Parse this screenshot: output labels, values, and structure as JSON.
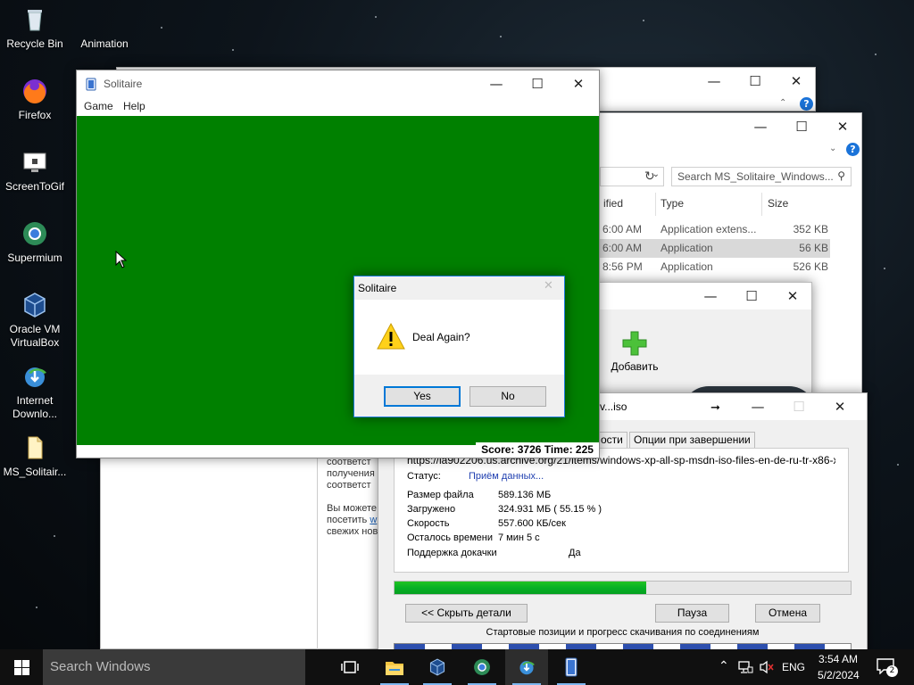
{
  "desktop": {
    "icons": [
      {
        "label": "Recycle Bin",
        "icon": "recycle-bin-icon"
      },
      {
        "label": "Animation",
        "icon": "animation-icon"
      },
      {
        "label": "Firefox",
        "icon": "firefox-icon"
      },
      {
        "label": "ScreenToGif",
        "icon": "screentogif-icon"
      },
      {
        "label": "Supermium",
        "icon": "supermium-icon"
      },
      {
        "label": "Oracle VM VirtualBox",
        "icon": "virtualbox-icon"
      },
      {
        "label": "Internet Downlo...",
        "icon": "idm-icon"
      },
      {
        "label": "MS_Solitair...",
        "icon": "file-icon"
      }
    ]
  },
  "explorer": {
    "search_placeholder": "Search MS_Solitaire_Windows...",
    "columns": {
      "modified": "ified",
      "type": "Type",
      "size": "Size"
    },
    "rows": [
      {
        "modified": "6:00 AM",
        "type": "Application extens...",
        "size": "352 KB",
        "selected": false
      },
      {
        "modified": "6:00 AM",
        "type": "Application",
        "size": "56 KB",
        "selected": true
      },
      {
        "modified": "8:56 PM",
        "type": "Application",
        "size": "526 KB",
        "selected": false
      }
    ]
  },
  "info_window": {
    "lines": [
      "соответст",
      "получения",
      "соответст",
      "",
      "Вы можете",
      "посетить",
      "свежих нов"
    ]
  },
  "idm_add": {
    "add_label": "Добавить"
  },
  "download": {
    "title": "rv...iso",
    "tabs": [
      "ости",
      "Опции при завершении"
    ],
    "url": "https://ia902206.us.archive.org/21/items/windows-xp-all-sp-msdn-iso-files-en-de-ru-tr-x86-x64/en_",
    "status_label": "Статус:",
    "status_value": "Приём данных...",
    "fields": [
      {
        "label": "Размер файла",
        "value": "589.136  МБ"
      },
      {
        "label": "Загружено",
        "value": "324.931  МБ  ( 55.15 % )"
      },
      {
        "label": "Скорость",
        "value": "557.600  КБ/сек"
      },
      {
        "label": "Осталось времени",
        "value": "7 мин 5 с"
      }
    ],
    "resume_label": "Поддержка докачки",
    "resume_value": "Да",
    "progress_percent": 55.15,
    "btn_details": "<< Скрыть детали",
    "btn_pause": "Пауза",
    "btn_cancel": "Отмена",
    "connections_label": "Стартовые позиции и прогресс скачивания по соединениям"
  },
  "solitaire": {
    "title": "Solitaire",
    "menu": [
      "Game",
      "Help"
    ],
    "score_text": "Score: 3726 Time: 225",
    "felt_color": "#008000"
  },
  "dialog": {
    "title": "Solitaire",
    "message": "Deal Again?",
    "yes": "Yes",
    "no": "No",
    "icon": "warning-icon"
  },
  "taskbar": {
    "search_placeholder": "Search Windows",
    "apps": [
      "file-explorer-icon",
      "virtualbox-icon",
      "supermium-icon",
      "idm-icon",
      "solitaire-icon"
    ],
    "language": "ENG",
    "time": "3:54 AM",
    "date": "5/2/2024",
    "notification_count": "2"
  }
}
